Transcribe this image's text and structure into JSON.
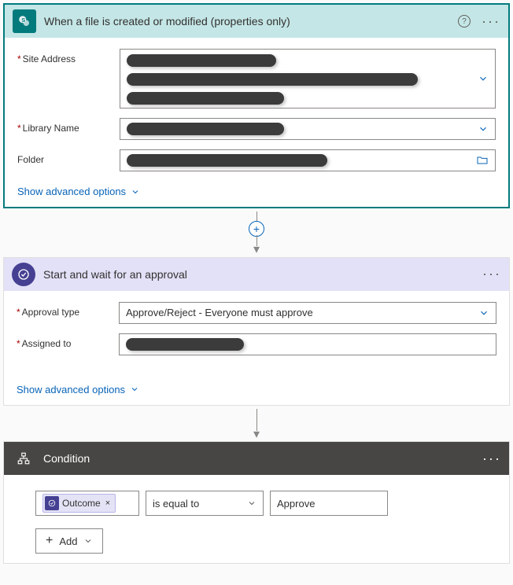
{
  "trigger": {
    "title": "When a file is created or modified (properties only)",
    "fields": {
      "site_address_label": "Site Address",
      "library_name_label": "Library Name",
      "folder_label": "Folder"
    },
    "advanced_label": "Show advanced options"
  },
  "approval": {
    "title": "Start and wait for an approval",
    "fields": {
      "approval_type_label": "Approval type",
      "approval_type_value": "Approve/Reject - Everyone must approve",
      "assigned_to_label": "Assigned to"
    },
    "advanced_label": "Show advanced options"
  },
  "condition": {
    "title": "Condition",
    "token_label": "Outcome",
    "operator": "is equal to",
    "value": "Approve",
    "add_label": "Add"
  }
}
